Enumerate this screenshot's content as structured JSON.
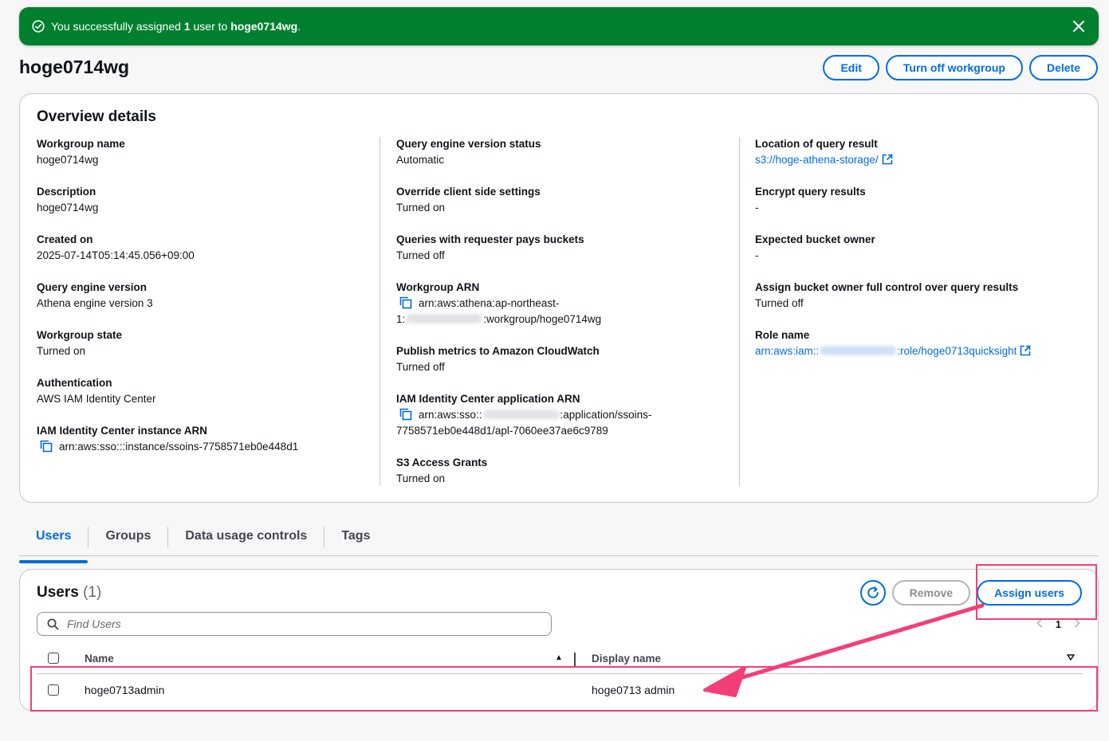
{
  "flash": {
    "prefix": "You successfully assigned ",
    "count": "1",
    "middle": " user to ",
    "target": "hoge0714wg",
    "suffix": "."
  },
  "page": {
    "title": "hoge0714wg"
  },
  "header_actions": {
    "edit": "Edit",
    "turn_off": "Turn off workgroup",
    "delete": "Delete"
  },
  "overview": {
    "title": "Overview details",
    "col1": [
      {
        "label": "Workgroup name",
        "value": "hoge0714wg"
      },
      {
        "label": "Description",
        "value": "hoge0714wg"
      },
      {
        "label": "Created on",
        "value": "2025-07-14T05:14:45.056+09:00"
      },
      {
        "label": "Query engine version",
        "value": "Athena engine version 3"
      },
      {
        "label": "Workgroup state",
        "value": "Turned on"
      },
      {
        "label": "Authentication",
        "value": "AWS IAM Identity Center"
      },
      {
        "label": "IAM Identity Center instance ARN",
        "value": "arn:aws:sso:::instance/ssoins-7758571eb0e448d1"
      }
    ],
    "col2": {
      "engine_status": {
        "label": "Query engine version status",
        "value": "Automatic"
      },
      "override": {
        "label": "Override client side settings",
        "value": "Turned on"
      },
      "requester_pays": {
        "label": "Queries with requester pays buckets",
        "value": "Turned off"
      },
      "workgroup_arn": {
        "label": "Workgroup ARN",
        "line1": "arn:aws:athena:ap-northeast-",
        "line2_prefix": "1:",
        "line2_suffix": ":workgroup/hoge0714wg"
      },
      "cloudwatch": {
        "label": "Publish metrics to Amazon CloudWatch",
        "value": "Turned off"
      },
      "idc_app_arn": {
        "label": "IAM Identity Center application ARN",
        "line1_prefix": "arn:aws:sso::",
        "line1_suffix": ":application/ssoins-",
        "line2": "7758571eb0e448d1/apl-7060ee37ae6c9789"
      },
      "s3_grants": {
        "label": "S3 Access Grants",
        "value": "Turned on"
      }
    },
    "col3": {
      "location": {
        "label": "Location of query result",
        "value": "s3://hoge-athena-storage/"
      },
      "encrypt": {
        "label": "Encrypt query results",
        "value": "-"
      },
      "bucket_owner": {
        "label": "Expected bucket owner",
        "value": "-"
      },
      "full_control": {
        "label": "Assign bucket owner full control over query results",
        "value": "Turned off"
      },
      "role": {
        "label": "Role name",
        "prefix": "arn:aws:iam::",
        "suffix": ":role/hoge0713quicksight"
      }
    }
  },
  "tabs": [
    "Users",
    "Groups",
    "Data usage controls",
    "Tags"
  ],
  "users": {
    "title": "Users",
    "count": "(1)",
    "remove": "Remove",
    "assign": "Assign users",
    "search_placeholder": "Find Users",
    "page": "1",
    "columns": {
      "name": "Name",
      "display_name": "Display name"
    },
    "rows": [
      {
        "name": "hoge0713admin",
        "display_name": "hoge0713 admin"
      }
    ]
  },
  "colors": {
    "accent": "#006ce0",
    "success": "#00802f",
    "annotation": "#f43e78"
  },
  "icons": [
    "success-check-icon",
    "close-icon",
    "copy-icon",
    "external-link-icon",
    "refresh-icon",
    "search-icon",
    "chevron-left-icon",
    "chevron-right-icon",
    "sort-ascending-icon",
    "sort-descending-icon"
  ]
}
